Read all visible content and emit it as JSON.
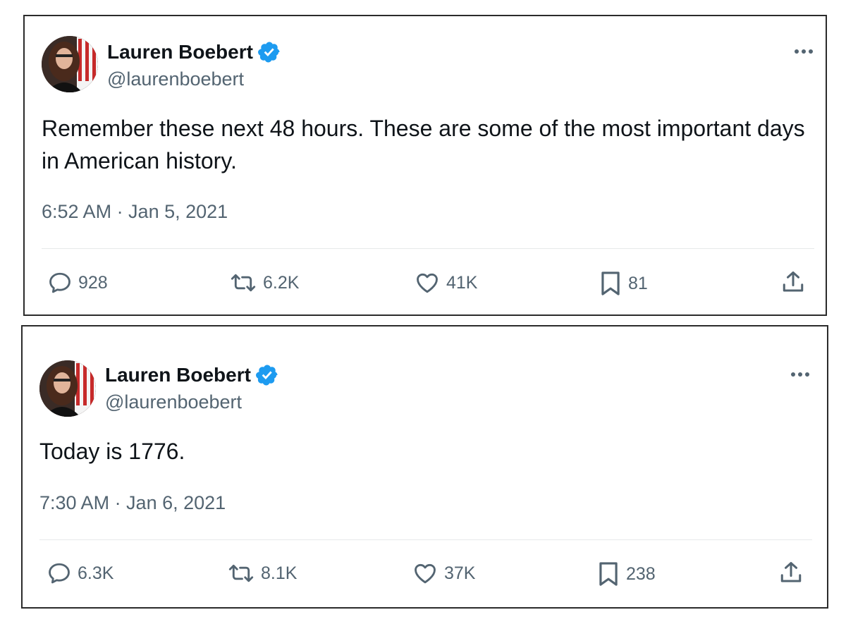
{
  "tweets": [
    {
      "author": {
        "name": "Lauren Boebert",
        "handle": "@laurenboebert",
        "verified_icon": "verified-badge-icon"
      },
      "text": "Remember these next 48 hours. These are some of the most important days in American history.",
      "timestamp": "6:52 AM · Jan 5, 2021",
      "metrics": {
        "replies": "928",
        "reposts": "6.2K",
        "likes": "41K",
        "bookmarks": "81"
      }
    },
    {
      "author": {
        "name": "Lauren Boebert",
        "handle": "@laurenboebert",
        "verified_icon": "verified-badge-icon"
      },
      "text": "Today is 1776.",
      "timestamp": "7:30 AM · Jan 6, 2021",
      "metrics": {
        "replies": "6.3K",
        "reposts": "8.1K",
        "likes": "37K",
        "bookmarks": "238"
      }
    }
  ],
  "colors": {
    "text_primary": "#0f1419",
    "text_secondary": "#536471",
    "verified_blue": "#1d9bf0",
    "divider": "#e7e9ea",
    "card_border": "#2b2b2b"
  },
  "icons": [
    "verified-badge-icon",
    "more-icon",
    "reply-icon",
    "repost-icon",
    "like-icon",
    "bookmark-icon",
    "share-icon"
  ]
}
